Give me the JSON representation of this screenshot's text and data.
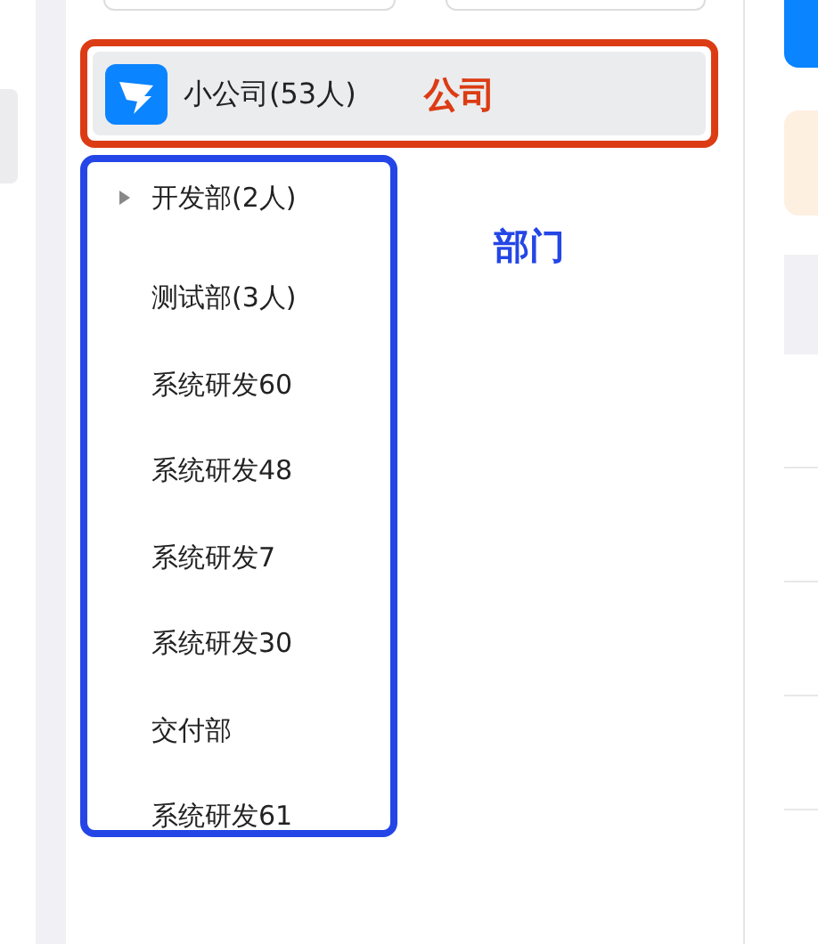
{
  "company": {
    "name": "小公司(53人)",
    "selected": true
  },
  "departments": [
    {
      "name": "开发部(2人)",
      "expandable": true
    },
    {
      "name": "测试部(3人)",
      "expandable": false
    },
    {
      "name": "系统研发60",
      "expandable": false
    },
    {
      "name": "系统研发48",
      "expandable": false
    },
    {
      "name": "系统研发7",
      "expandable": false
    },
    {
      "name": "系统研发30",
      "expandable": false
    },
    {
      "name": "交付部",
      "expandable": false
    },
    {
      "name": "系统研发61",
      "expandable": false
    }
  ],
  "annotations": [
    {
      "label": "公司",
      "color": "#dc3c14"
    },
    {
      "label": "部门",
      "color": "#2446e6"
    }
  ]
}
